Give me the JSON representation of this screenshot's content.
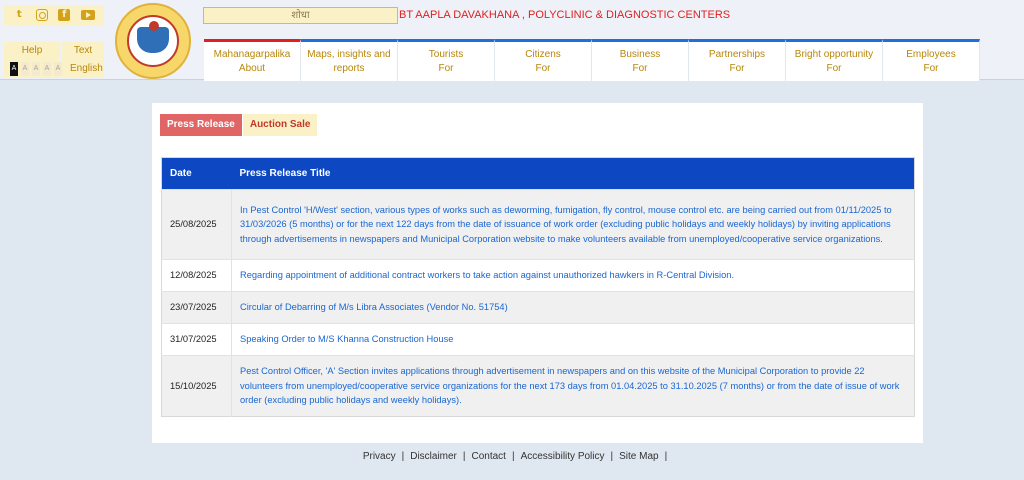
{
  "header": {
    "social": [
      {
        "icon": "twitter-icon",
        "glyph": "t"
      },
      {
        "icon": "instagram-icon",
        "glyph": ""
      },
      {
        "icon": "facebook-icon",
        "glyph": "f"
      },
      {
        "icon": "youtube-icon",
        "glyph": ""
      }
    ],
    "help_label": "Help",
    "text_label": "Text",
    "language": "English",
    "font_sizes": [
      "A",
      "A",
      "A",
      "A",
      "A"
    ],
    "search_placeholder": "शोधा",
    "ticker": "BT AAPLA DAVAKHANA , POLYCLINIC & DIAGNOSTIC CENTERS",
    "nav": [
      {
        "line1": "Mahanagarpalika",
        "line2": "About"
      },
      {
        "line1": "Maps, insights and",
        "line2": "reports"
      },
      {
        "line1": "Tourists",
        "line2": "For"
      },
      {
        "line1": "Citizens",
        "line2": "For"
      },
      {
        "line1": "Business",
        "line2": "For"
      },
      {
        "line1": "Partnerships",
        "line2": "For"
      },
      {
        "line1": "Bright opportunity",
        "line2": "For"
      },
      {
        "line1": "Employees",
        "line2": "For"
      }
    ]
  },
  "tabs": {
    "press_release": "Press Release",
    "auction_sale": "Auction Sale"
  },
  "table": {
    "headers": {
      "date": "Date",
      "title": "Press Release Title"
    },
    "rows": [
      {
        "date": "25/08/2025",
        "title": "In Pest Control 'H/West' section, various types of works such as deworming, fumigation, fly control, mouse control etc. are being carried out from 01/11/2025 to 31/03/2026 (5 months) or for the next 122 days from the date of issuance of work order (excluding public holidays and weekly holidays) by inviting applications through advertisements in newspapers and Municipal Corporation website to make volunteers available from unemployed/cooperative service organizations."
      },
      {
        "date": "12/08/2025",
        "title": "Regarding appointment of additional contract workers to take action against unauthorized hawkers in R-Central Division."
      },
      {
        "date": "23/07/2025",
        "title": "Circular of Debarring of M/s Libra Associates (Vendor No. 51754)"
      },
      {
        "date": "31/07/2025",
        "title": "Speaking Order to M/S Khanna Construction House"
      },
      {
        "date": "15/10/2025",
        "title": "Pest Control Officer, 'A' Section invites applications through advertisement in newspapers and on this website of the Municipal Corporation to provide 22 volunteers from unemployed/cooperative service organizations for the next 173 days from 01.04.2025 to 31.10.2025 (7 months) or from the date of issue of work order (excluding public holidays and weekly holidays)."
      }
    ]
  },
  "footer": {
    "privacy": "Privacy",
    "disclaimer": "Disclaimer",
    "contact": "Contact",
    "accessibility": "Accessibility Policy",
    "sitemap": "Site Map",
    "separator": "|"
  }
}
